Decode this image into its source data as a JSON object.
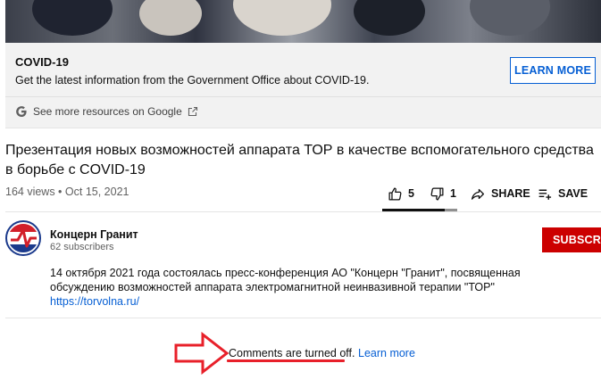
{
  "covid": {
    "title": "COVID-19",
    "description": "Get the latest information from the Government Office about COVID-19.",
    "learn_more": "LEARN MORE",
    "see_more": "See more resources on Google"
  },
  "video": {
    "title": "Презентация новых возможностей аппарата ТОР в качестве вспомогательного средства в борьбе с COVID-19",
    "meta": "164 views • Oct 15, 2021",
    "likes": "5",
    "dislikes": "1",
    "share": "SHARE",
    "save": "SAVE",
    "like_ratio": 0.83
  },
  "channel": {
    "name": "Концерн Гранит",
    "subscribers": "62 subscribers",
    "subscribe": "SUBSCRIBE"
  },
  "description": {
    "line1": "14 октября 2021 года состоялась пресс-конференция АО \"Концерн \"Гранит\", посвященная",
    "line2": "обсуждению возможностей аппарата электромагнитной неинвазивной терапии \"ТОР\"",
    "link": "https://torvolna.ru/"
  },
  "comments": {
    "status": "Comments are turned off.",
    "learn_more": "Learn more"
  },
  "colors": {
    "accent_blue": "#065fd4",
    "subscribe_red": "#cc0000",
    "annotation_red": "#e8202a"
  }
}
